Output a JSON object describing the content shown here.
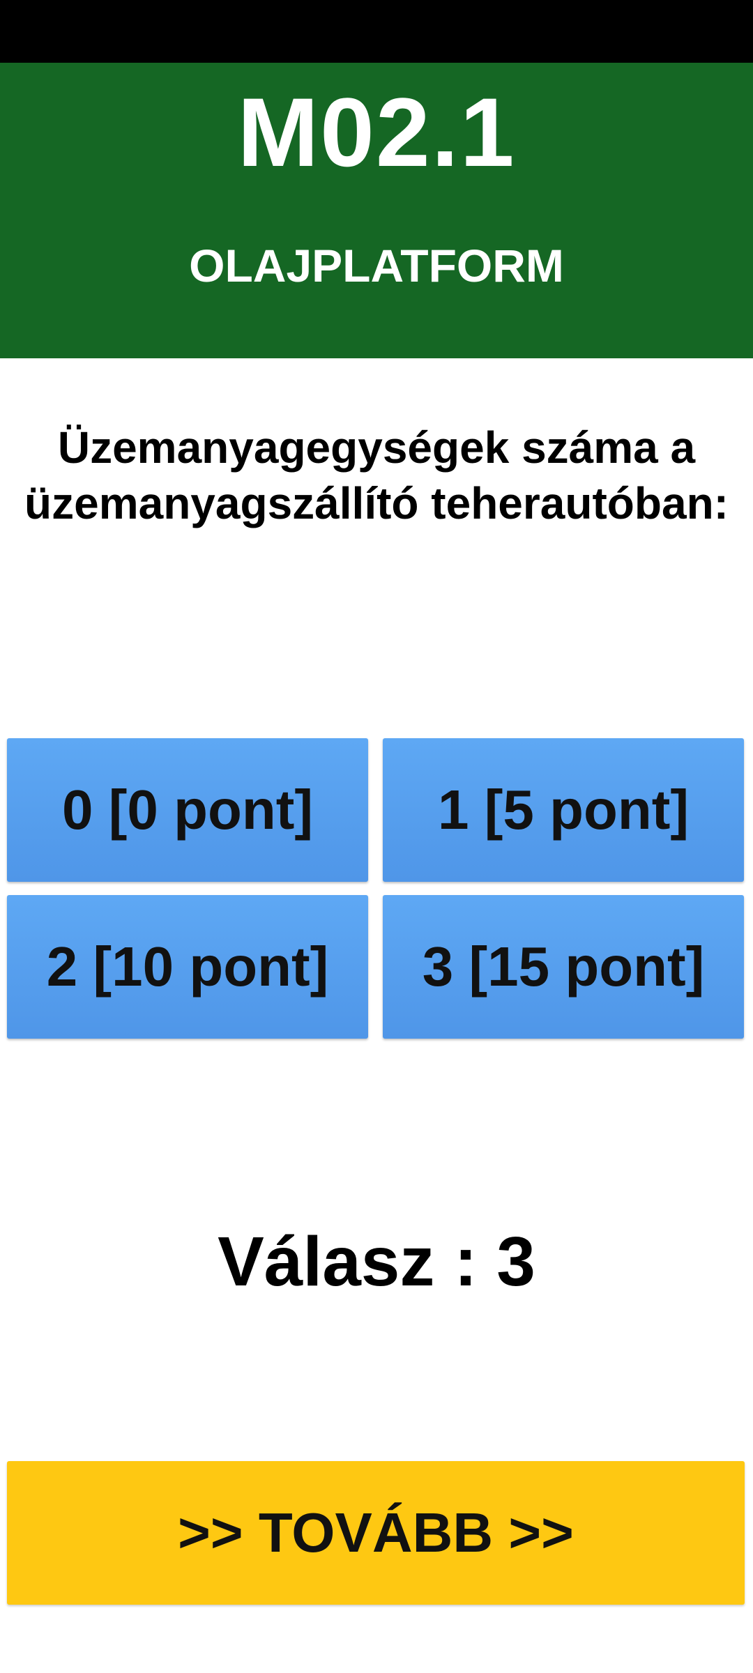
{
  "header": {
    "code": "M02.1",
    "subtitle": "OLAJPLATFORM"
  },
  "question": {
    "line1": "Üzemanyagegységek száma a",
    "line2": "üzemanyagszállító teherautóban:"
  },
  "options": [
    {
      "label": "0 [0 pont]"
    },
    {
      "label": "1 [5 pont]"
    },
    {
      "label": "2 [10 pont]"
    },
    {
      "label": "3 [15 pont]"
    }
  ],
  "answer": {
    "text": "Válasz : 3"
  },
  "next_button": {
    "label": ">> TOVÁBB >>"
  },
  "colors": {
    "header_bg": "#156724",
    "option_bg": "#5ea8f4",
    "next_bg": "#fec812"
  }
}
